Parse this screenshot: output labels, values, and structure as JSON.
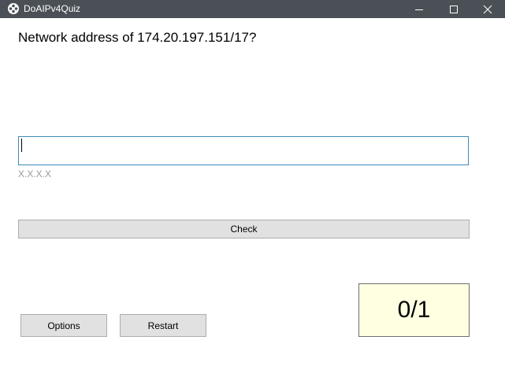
{
  "window": {
    "title": "DoAIPv4Quiz",
    "title_bar_color": "#4a5056",
    "controls": [
      "minimize-icon",
      "maximize-icon",
      "close-icon"
    ]
  },
  "quiz": {
    "question": "Network address of 174.20.197.151/17?",
    "answer_value": "",
    "answer_hint": "X.X.X.X"
  },
  "buttons": {
    "check_label": "Check",
    "options_label": "Options",
    "restart_label": "Restart"
  },
  "score": {
    "text": "0/1",
    "background": "#ffffe1"
  },
  "colors": {
    "input_border": "#3c8ab8",
    "button_face": "#e1e1e1"
  }
}
